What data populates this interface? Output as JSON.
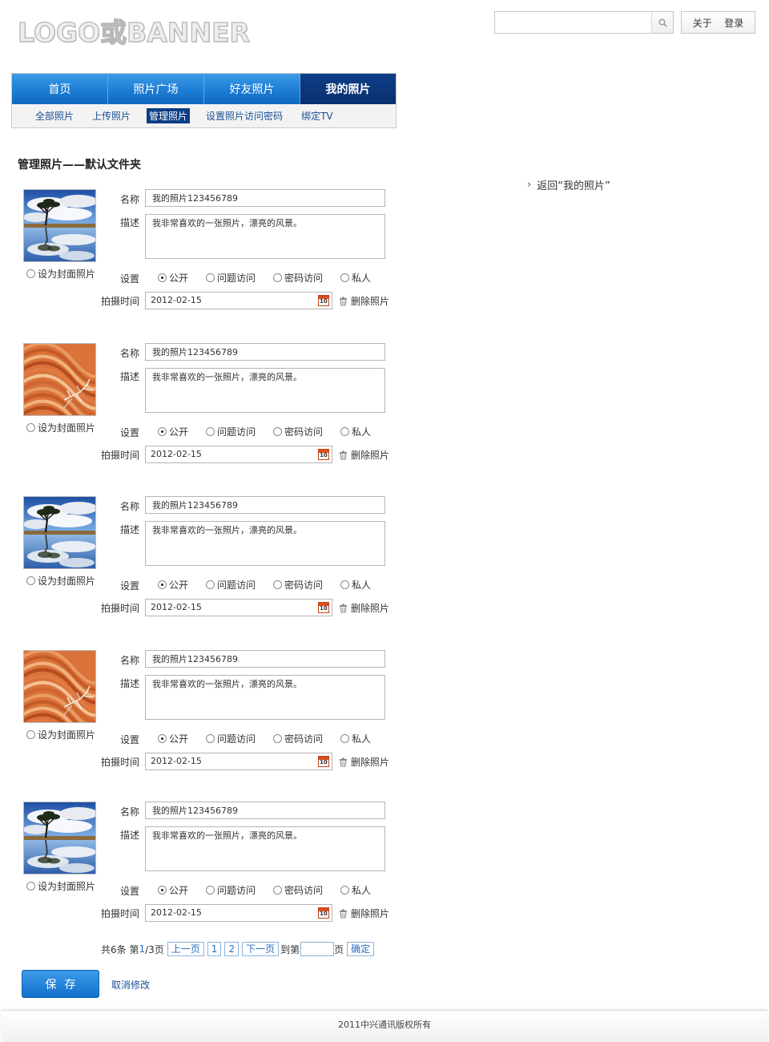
{
  "header": {
    "logo_text": "LOGO或BANNER",
    "search_placeholder": "",
    "links": [
      "关于",
      "登录"
    ]
  },
  "nav": {
    "tabs": [
      {
        "label": "首页",
        "active": false
      },
      {
        "label": "照片广场",
        "active": false
      },
      {
        "label": "好友照片",
        "active": false
      },
      {
        "label": "我的照片",
        "active": true
      }
    ],
    "subtabs": [
      {
        "label": "全部照片",
        "active": false
      },
      {
        "label": "上传照片",
        "active": false
      },
      {
        "label": "管理照片",
        "active": true
      },
      {
        "label": "设置照片访问密码",
        "active": false
      },
      {
        "label": "绑定TV",
        "active": false
      }
    ]
  },
  "page_title": "管理照片——默认文件夹",
  "back_link": "返回“我的照片”",
  "labels": {
    "name": "名称",
    "desc": "描述",
    "settings": "设置",
    "time": "拍摄时间",
    "cover": "设为封面照片",
    "delete": "删除照片",
    "options": [
      "公开",
      "问题访问",
      "密码访问",
      "私人"
    ]
  },
  "photos": [
    {
      "image": "tree-reflection",
      "name": "我的照片123456789",
      "desc": "我非常喜欢的一张照片，漂亮的风景。",
      "visibility": "公开",
      "date": "2012-02-15"
    },
    {
      "image": "sand-waves",
      "name": "我的照片123456789",
      "desc": "我非常喜欢的一张照片，漂亮的风景。",
      "visibility": "公开",
      "date": "2012-02-15"
    },
    {
      "image": "tree-reflection",
      "name": "我的照片123456789",
      "desc": "我非常喜欢的一张照片，漂亮的风景。",
      "visibility": "公开",
      "date": "2012-02-15"
    },
    {
      "image": "sand-waves",
      "name": "我的照片123456789",
      "desc": "我非常喜欢的一张照片，漂亮的风景。",
      "visibility": "公开",
      "date": "2012-02-15"
    },
    {
      "image": "tree-reflection",
      "name": "我的照片123456789",
      "desc": "我非常喜欢的一张照片，漂亮的风景。",
      "visibility": "公开",
      "date": "2012-02-15"
    }
  ],
  "calendar_icon_text": "10",
  "pagination": {
    "total_prefix": "共6条 第 ",
    "current": "1",
    "total_suffix": "/3页",
    "prev": "上一页",
    "pages": [
      "1",
      "2"
    ],
    "next": "下一页",
    "goto_prefix": "到第",
    "goto_suffix": "页",
    "confirm": "确定"
  },
  "actions": {
    "save": "保存",
    "cancel": "取消修改"
  },
  "footer": "2011中兴通讯版权所有",
  "colors": {
    "nav_blue": "#1f7fd5",
    "nav_active": "#0c3e86",
    "link_blue": "#1a4f96"
  }
}
